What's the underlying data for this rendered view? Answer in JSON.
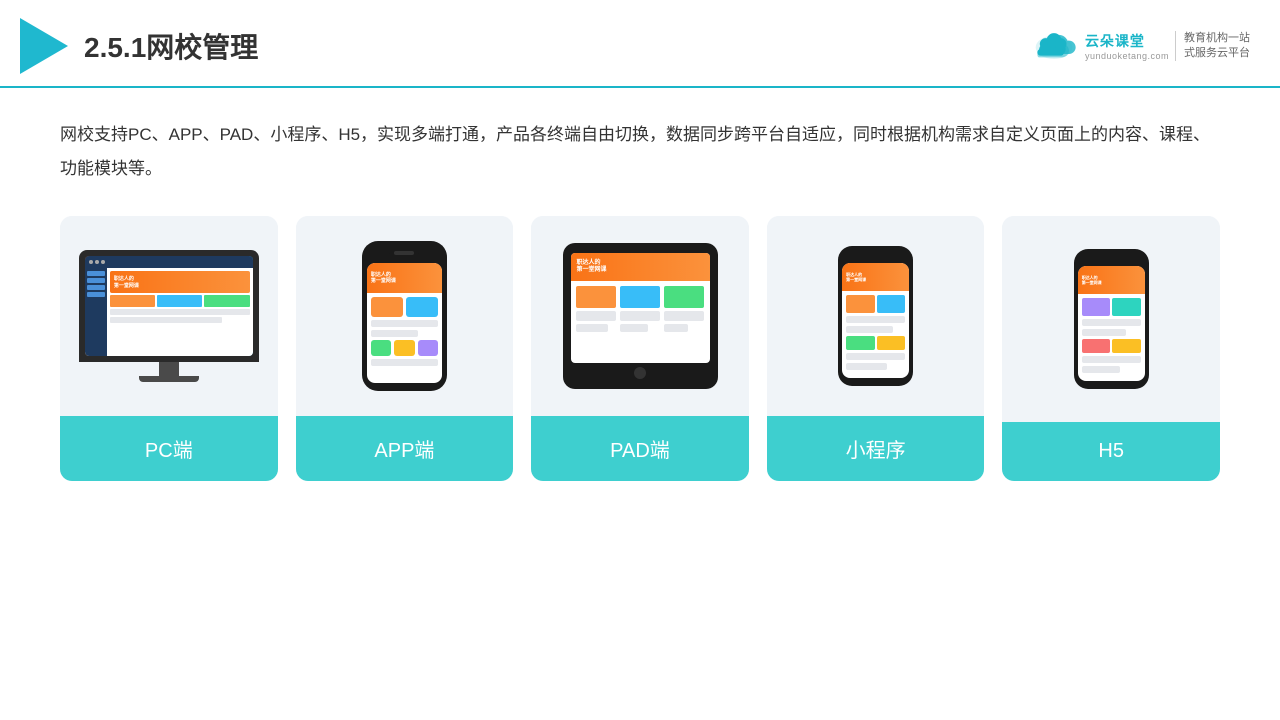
{
  "header": {
    "title": "2.5.1网校管理",
    "brand": {
      "name": "云朵课堂",
      "url": "yunduoketang.com",
      "tagline": "教育机构一站\n式服务云平台"
    }
  },
  "description": "网校支持PC、APP、PAD、小程序、H5，实现多端打通，产品各终端自由切换，数据同步跨平台自适应，同时根据机构需求自定义页面上的内容、课程、功能模块等。",
  "cards": [
    {
      "id": "pc",
      "label": "PC端"
    },
    {
      "id": "app",
      "label": "APP端"
    },
    {
      "id": "pad",
      "label": "PAD端"
    },
    {
      "id": "miniprogram",
      "label": "小程序"
    },
    {
      "id": "h5",
      "label": "H5"
    }
  ]
}
